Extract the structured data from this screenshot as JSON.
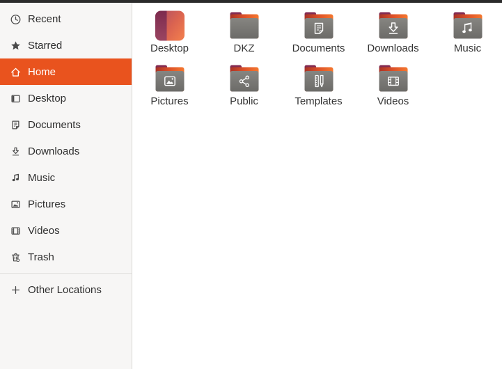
{
  "window": {
    "app": "Files",
    "topbar_color": "#2b2b2b"
  },
  "colors": {
    "accent_orange": "#e9531e",
    "sidebar_bg": "#f7f6f5",
    "folder_gray_top": "#858480",
    "folder_gray_bottom": "#6d6c69",
    "folder_tab_maroon": "#7c2a4d",
    "folder_back_orange": "#ee5f2b",
    "main_bg": "#ffffff"
  },
  "sidebar": {
    "items": [
      {
        "label": "Recent",
        "icon": "recent-clock-icon",
        "selected": false
      },
      {
        "label": "Starred",
        "icon": "star-icon",
        "selected": false
      },
      {
        "label": "Home",
        "icon": "home-icon",
        "selected": true
      },
      {
        "label": "Desktop",
        "icon": "desktop-icon",
        "selected": false
      },
      {
        "label": "Documents",
        "icon": "documents-icon",
        "selected": false
      },
      {
        "label": "Downloads",
        "icon": "downloads-icon",
        "selected": false
      },
      {
        "label": "Music",
        "icon": "music-note-icon",
        "selected": false
      },
      {
        "label": "Pictures",
        "icon": "pictures-icon",
        "selected": false
      },
      {
        "label": "Videos",
        "icon": "videos-film-icon",
        "selected": false
      },
      {
        "label": "Trash",
        "icon": "trash-icon",
        "selected": false
      }
    ],
    "other_locations": {
      "label": "Other Locations",
      "icon": "plus-icon"
    }
  },
  "folders": {
    "items": [
      {
        "name": "Desktop",
        "icon": "desktop-gradient-folder-icon"
      },
      {
        "name": "DKZ",
        "icon": "plain-folder-icon"
      },
      {
        "name": "Documents",
        "icon": "documents-folder-icon"
      },
      {
        "name": "Downloads",
        "icon": "downloads-folder-icon"
      },
      {
        "name": "Music",
        "icon": "music-folder-icon"
      },
      {
        "name": "Pictures",
        "icon": "pictures-folder-icon"
      },
      {
        "name": "Public",
        "icon": "public-share-folder-icon"
      },
      {
        "name": "Templates",
        "icon": "templates-folder-icon"
      },
      {
        "name": "Videos",
        "icon": "videos-folder-icon"
      }
    ]
  }
}
